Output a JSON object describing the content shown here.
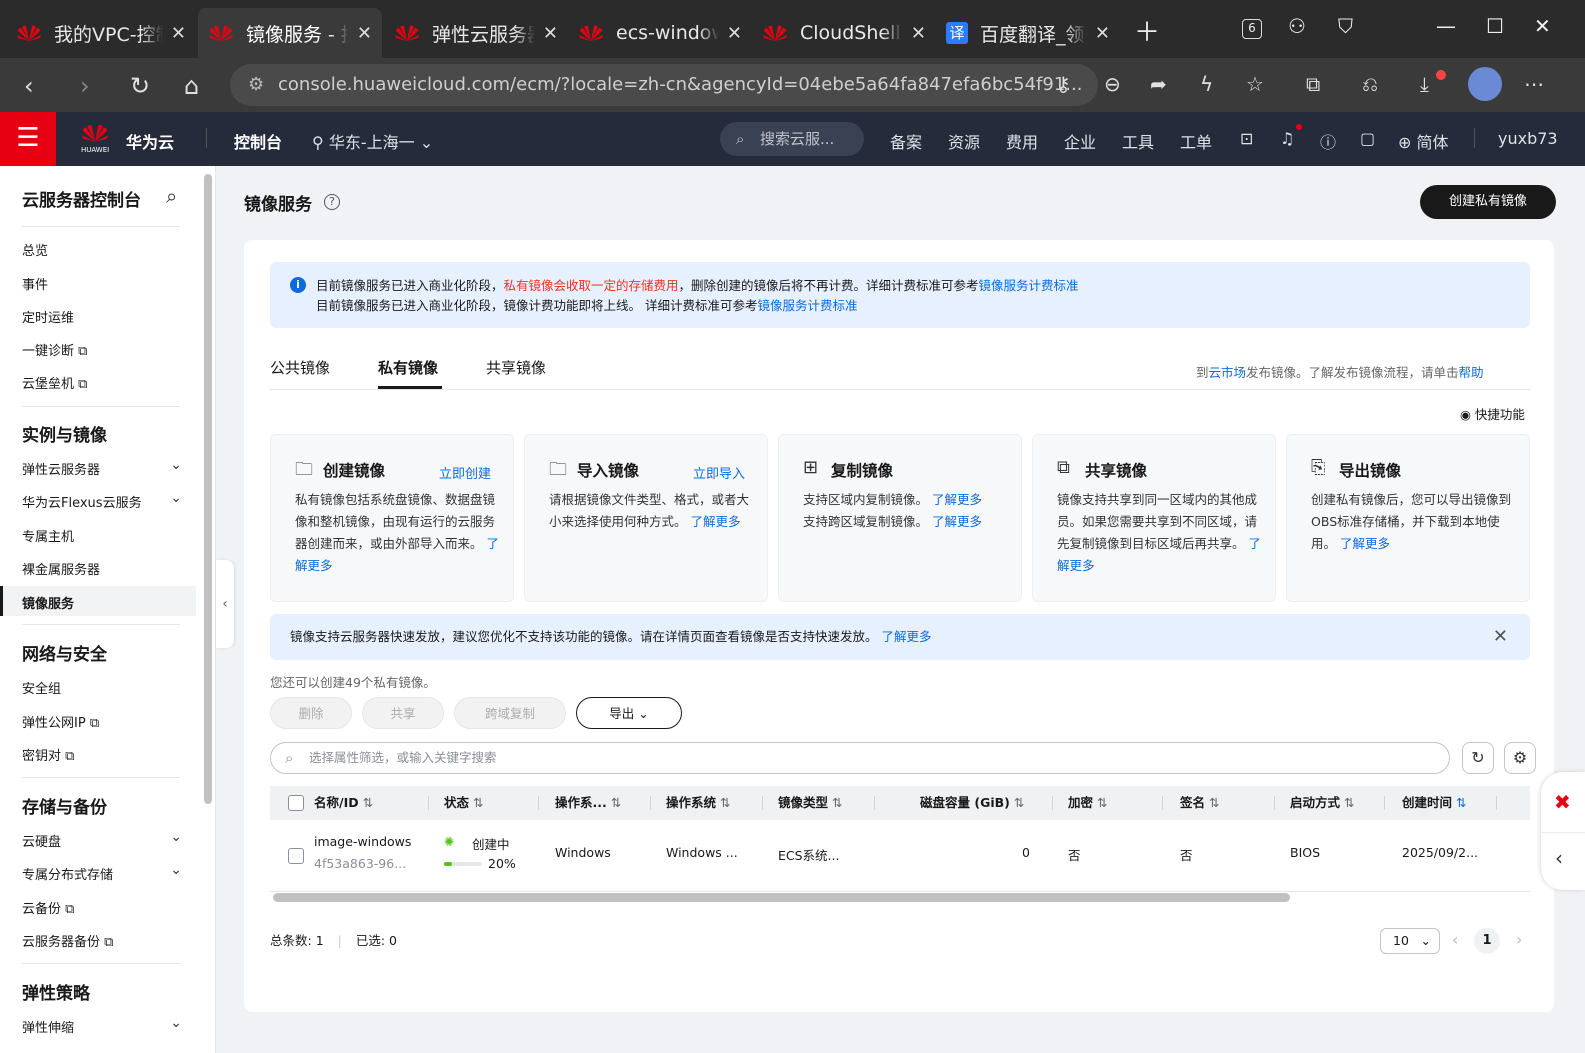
{
  "browser": {
    "tabs": [
      {
        "title": "我的VPC-控制台",
        "active": false
      },
      {
        "title": "镜像服务 - 控制台",
        "active": true
      },
      {
        "title": "弹性云服务器",
        "active": false
      },
      {
        "title": "ecs-windows",
        "active": false
      },
      {
        "title": "CloudShell",
        "active": false
      },
      {
        "title": "百度翻译_领先",
        "active": false,
        "favicon_text": "译"
      }
    ],
    "url": "console.huaweicloud.com/ecm/?locale=zh-cn&agencyId=04ebe5a64fa847efa6bc54f91...",
    "tab_count_badge": "6"
  },
  "topnav": {
    "brand": "华为云",
    "brand_sub": "HUAWEI",
    "console": "控制台",
    "region": "华东-上海一",
    "search_placeholder": "搜索云服...",
    "items": [
      "备案",
      "资源",
      "费用",
      "企业",
      "工具",
      "工单"
    ],
    "lang": "简体",
    "user": "yuxb73"
  },
  "sidebar": {
    "title": "云服务器控制台",
    "group0": [
      "总览",
      "事件",
      "定时运维",
      "一键诊断",
      "云堡垒机"
    ],
    "section1": "实例与镜像",
    "group1": [
      "弹性云服务器",
      "华为云Flexus云服务",
      "专属主机",
      "裸金属服务器",
      "镜像服务"
    ],
    "section2": "网络与安全",
    "group2": [
      "安全组",
      "弹性公网IP",
      "密钥对"
    ],
    "section3": "存储与备份",
    "group3": [
      "云硬盘",
      "专属分布式存储",
      "云备份",
      "云服务器备份"
    ],
    "section4": "弹性策略",
    "group4": [
      "弹性伸缩"
    ]
  },
  "page": {
    "title": "镜像服务",
    "create_btn": "创建私有镜像",
    "notice": {
      "l1a": "目前镜像服务已进入商业化阶段，",
      "l1b": "私有镜像会收取一定的存储费用",
      "l1c": "，删除创建的镜像后将不再计费。详细计费标准可参考",
      "l1d": "镜像服务计费标准",
      "l2a": "目前镜像服务已进入商业化阶段，镜像计费功能即将上线。 详细计费标准可参考",
      "l2b": "镜像服务计费标准"
    },
    "tabs": [
      "公共镜像",
      "私有镜像",
      "共享镜像"
    ],
    "market": {
      "a": "到",
      "b": "云市场",
      "c": "发布镜像。了解发布镜像流程，请单击",
      "d": "帮助"
    },
    "quick": "快捷功能",
    "features": [
      {
        "title": "创建镜像",
        "link": "立即创建",
        "desc": "私有镜像包括系统盘镜像、数据盘镜像和整机镜像，由现有运行的云服务器创建而来，或由外部导入而来。",
        "more": "了解更多"
      },
      {
        "title": "导入镜像",
        "link": "立即导入",
        "desc": "请根据镜像文件类型、格式，或者大小来选择使用何种方式。",
        "more": "了解更多"
      },
      {
        "title": "复制镜像",
        "link": "",
        "desc": "支持区域内复制镜像。",
        "desc2": "支持跨区域复制镜像。",
        "more": "了解更多",
        "more2": "了解更多"
      },
      {
        "title": "共享镜像",
        "link": "",
        "desc": "镜像支持共享到同一区域内的其他成员。如果您需要共享到不同区域，请先复制镜像到目标区域后再共享。",
        "more": "了解更多"
      },
      {
        "title": "导出镜像",
        "link": "",
        "desc": "创建私有镜像后，您可以导出镜像到OBS标准存储桶，并下载到本地使用。",
        "more": "了解更多"
      }
    ],
    "tip": "镜像支持云服务器快速发放，建议您优化不支持该功能的镜像。请在详情页面查看镜像是否支持快速发放。",
    "tip_more": "了解更多",
    "quota": "您还可以创建49个私有镜像。",
    "ops": [
      "删除",
      "共享",
      "跨域复制",
      "导出"
    ],
    "filter_placeholder": "选择属性筛选，或输入关键字搜索",
    "columns": [
      "名称/ID",
      "状态",
      "操作系...",
      "操作系统",
      "镜像类型",
      "磁盘容量 (GiB)",
      "加密",
      "签名",
      "启动方式",
      "创建时间"
    ],
    "row": {
      "name": "image-windows",
      "id": "4f53a863-96...",
      "status": "创建中",
      "progress": "20%",
      "progress_value": 0.2,
      "os_type": "Windows",
      "os": "Windows ...",
      "img_type": "ECS系统...",
      "disk": "0",
      "encrypt": "否",
      "sign": "否",
      "boot": "BIOS",
      "created": "2025/09/2..."
    },
    "pager": {
      "total_label": "总条数:",
      "total": "1",
      "selected_label": "已选:",
      "selected": "0",
      "size": "10",
      "page": "1"
    }
  },
  "colors": {
    "accent": "#0d6ade",
    "brand_red": "#e60012",
    "nav_bg": "#252b3a",
    "warn_red": "#e32"
  }
}
